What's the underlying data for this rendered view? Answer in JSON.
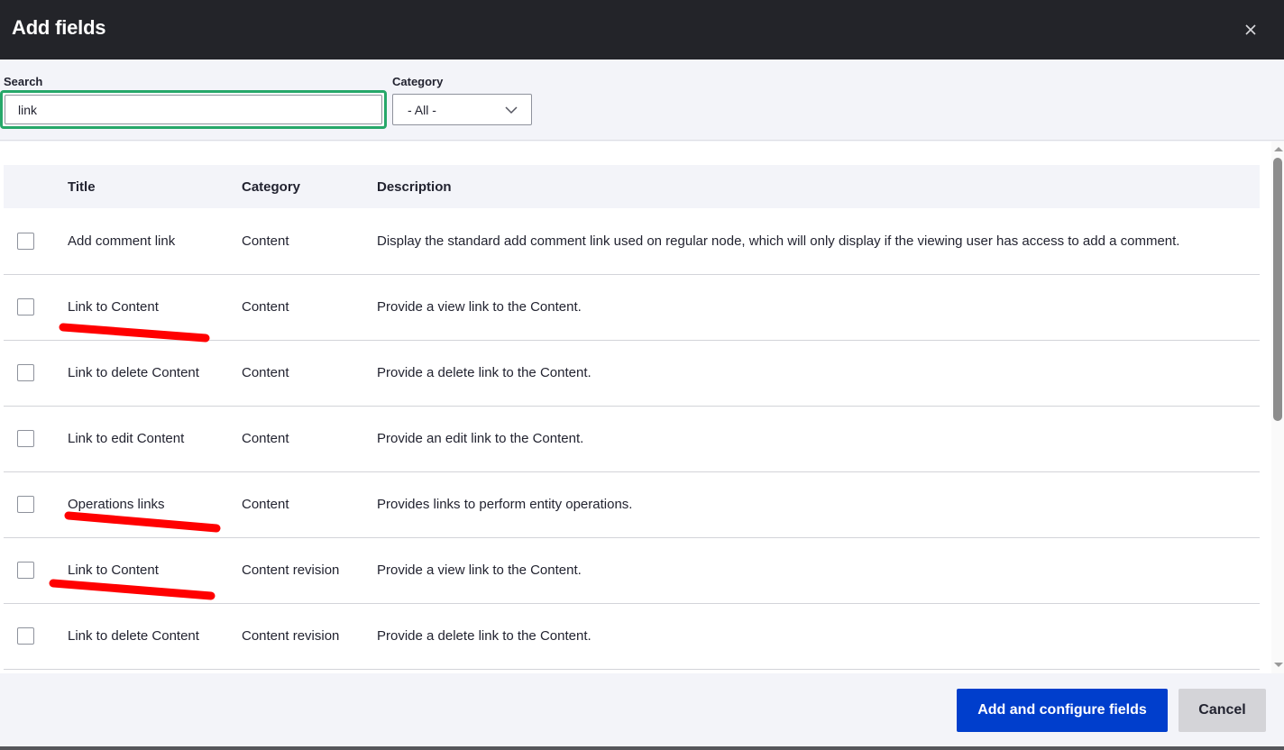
{
  "dialog": {
    "title": "Add fields",
    "close_label": "Close"
  },
  "filters": {
    "search_label": "Search",
    "search_value": "link",
    "category_label": "Category",
    "category_selected": "- All -"
  },
  "table": {
    "columns": [
      "Title",
      "Category",
      "Description"
    ],
    "rows": [
      {
        "title": "Add comment link",
        "category": "Content",
        "description": "Display the standard add comment link used on regular node, which will only display if the viewing user has access to add a comment.",
        "checked": false,
        "highlighted": false
      },
      {
        "title": "Link to Content",
        "category": "Content",
        "description": "Provide a view link to the Content.",
        "checked": false,
        "highlighted": true
      },
      {
        "title": "Link to delete Content",
        "category": "Content",
        "description": "Provide a delete link to the Content.",
        "checked": false,
        "highlighted": false
      },
      {
        "title": "Link to edit Content",
        "category": "Content",
        "description": "Provide an edit link to the Content.",
        "checked": false,
        "highlighted": false
      },
      {
        "title": "Operations links",
        "category": "Content",
        "description": "Provides links to perform entity operations.",
        "checked": false,
        "highlighted": true
      },
      {
        "title": "Link to Content",
        "category": "Content revision",
        "description": "Provide a view link to the Content.",
        "checked": false,
        "highlighted": true
      },
      {
        "title": "Link to delete Content",
        "category": "Content revision",
        "description": "Provide a delete link to the Content.",
        "checked": false,
        "highlighted": false
      }
    ]
  },
  "footer": {
    "primary_label": "Add and configure fields",
    "cancel_label": "Cancel"
  },
  "colors": {
    "titlebar": "#232429",
    "focus_ring": "#26a769",
    "primary": "#003ecc",
    "annotation": "#ff0000"
  }
}
